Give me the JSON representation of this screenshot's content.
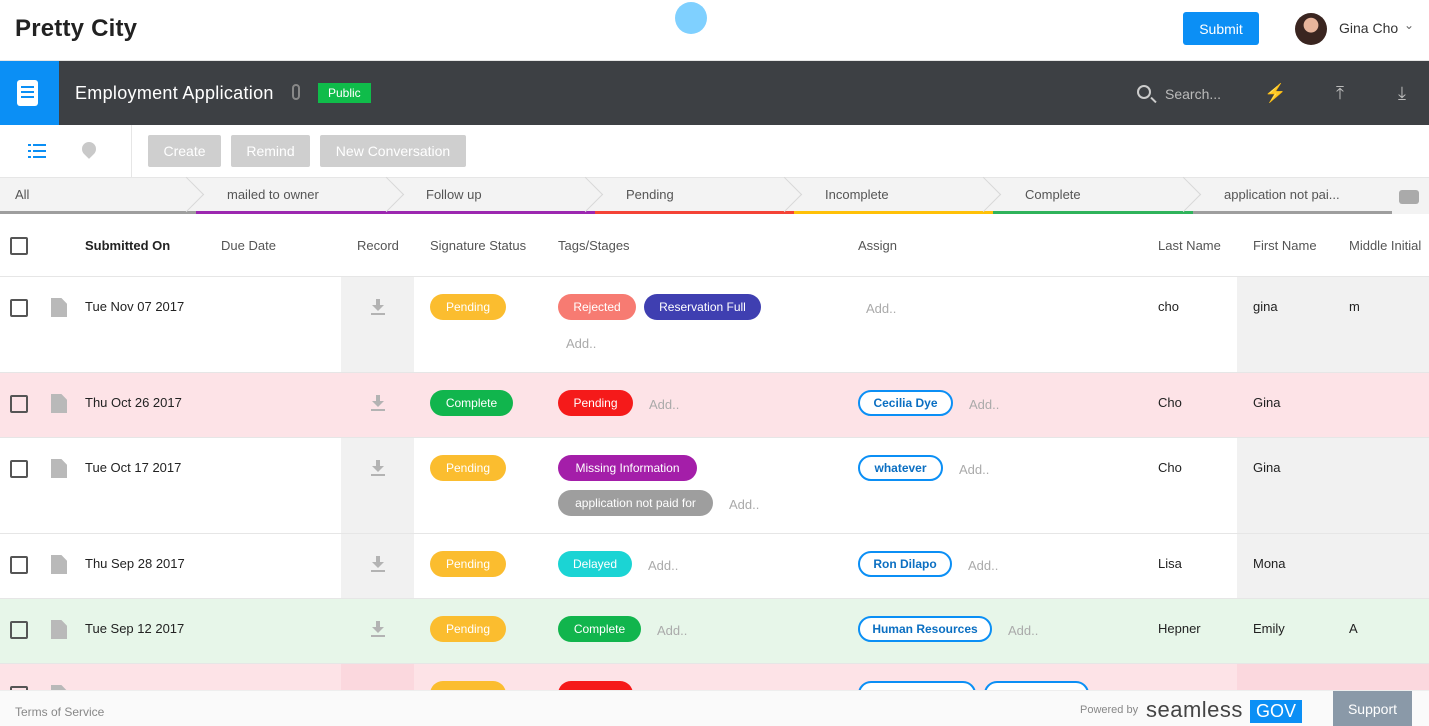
{
  "topbar": {
    "brand": "Pretty City",
    "submit_label": "Submit",
    "user_name": "Gina Cho"
  },
  "appbar": {
    "title": "Employment Application",
    "visibility_badge": "Public",
    "search_placeholder": "Search..."
  },
  "toolbar": {
    "create_label": "Create",
    "remind_label": "Remind",
    "new_conversation_label": "New Conversation"
  },
  "stages": [
    {
      "label": "All",
      "color": "#9e9e9e"
    },
    {
      "label": "mailed to owner",
      "color": "#9c27b0"
    },
    {
      "label": "Follow up",
      "color": "#9c27b0"
    },
    {
      "label": "Pending",
      "color": "#f44336"
    },
    {
      "label": "Incomplete",
      "color": "#ffc107"
    },
    {
      "label": "Complete",
      "color": "#2fb35b"
    },
    {
      "label": "application not pai...",
      "color": "#9e9e9e"
    }
  ],
  "columns": {
    "submitted_on": "Submitted On",
    "due_date": "Due Date",
    "record": "Record",
    "signature_status": "Signature Status",
    "tags_stages": "Tags/Stages",
    "assign": "Assign",
    "last_name": "Last Name",
    "first_name": "First Name",
    "middle_initial": "Middle Initial"
  },
  "add_text": "Add..",
  "rows": [
    {
      "submitted": "Tue Nov 07 2017",
      "signature": "Pending",
      "tags": [
        "Rejected",
        "Reservation Full"
      ],
      "assignees": [],
      "last_name": "cho",
      "first_name": "gina",
      "middle_initial": "m",
      "highlight": "none"
    },
    {
      "submitted": "Thu Oct 26 2017",
      "signature": "Complete",
      "tags": [
        "Pending"
      ],
      "assignees": [
        "Cecilia Dye"
      ],
      "last_name": "Cho",
      "first_name": "Gina",
      "middle_initial": "",
      "highlight": "pink"
    },
    {
      "submitted": "Tue Oct 17 2017",
      "signature": "Pending",
      "tags": [
        "Missing Information",
        "application not paid for"
      ],
      "assignees": [
        "whatever"
      ],
      "last_name": "Cho",
      "first_name": "Gina",
      "middle_initial": "",
      "highlight": "none"
    },
    {
      "submitted": "Thu Sep 28 2017",
      "signature": "Pending",
      "tags": [
        "Delayed"
      ],
      "assignees": [
        "Ron Dilapo"
      ],
      "last_name": "Lisa",
      "first_name": "Mona",
      "middle_initial": "",
      "highlight": "none"
    },
    {
      "submitted": "Tue Sep 12 2017",
      "signature": "Pending",
      "tags": [
        "Complete"
      ],
      "assignees": [
        "Human Resources"
      ],
      "last_name": "Hepner",
      "first_name": "Emily",
      "middle_initial": "A",
      "highlight": "green"
    }
  ],
  "colors": {
    "accent": "#0b8ff5",
    "pending": "#fbbd2f",
    "complete": "#11b54d",
    "rejected": "#f77b72",
    "reservation_full": "#3f3fb1",
    "tag_pending": "#f51a1a",
    "missing_information": "#a41ea9",
    "application_not_paid": "#9e9e9e",
    "delayed": "#1bd4d4",
    "row_pink": "#fde3e7",
    "row_green": "#e7f6e9"
  },
  "footer": {
    "terms": "Terms of Service",
    "powered_by": "Powered by",
    "brand_word": "seamless",
    "brand_box": "GOV",
    "support_label": "Support"
  },
  "icons": [
    "document-icon",
    "paperclip-icon",
    "search-icon",
    "lightning-icon",
    "upload-icon",
    "download-icon",
    "list-view-icon",
    "map-pin-icon",
    "file-icon",
    "gear-icon",
    "chevron-down-icon"
  ]
}
